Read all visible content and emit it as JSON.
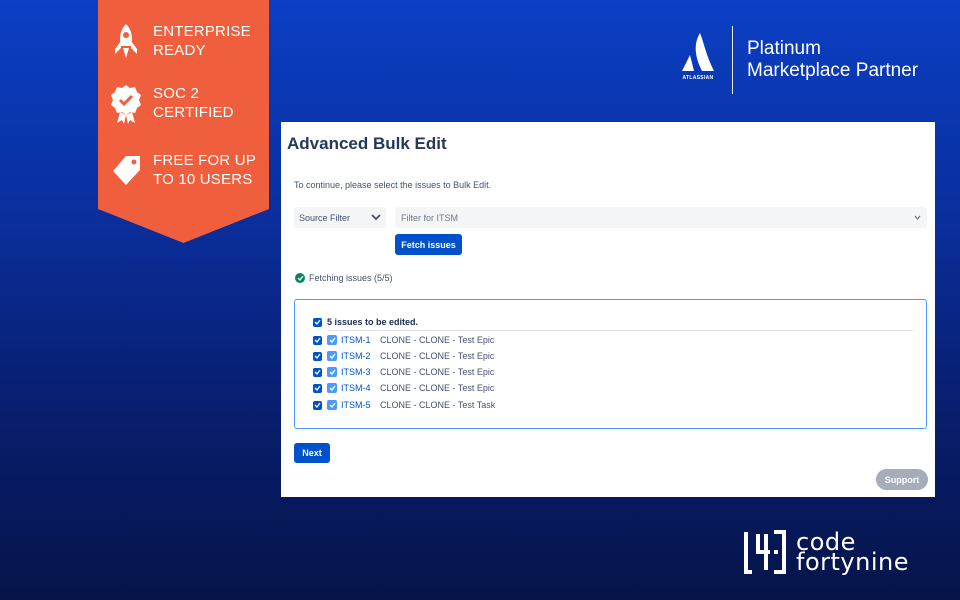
{
  "ribbon": {
    "items": [
      {
        "icon": "rocket-icon",
        "label": "ENTERPRISE READY"
      },
      {
        "icon": "certified-badge-icon",
        "label": "SOC 2 CERTIFIED"
      },
      {
        "icon": "tag-icon",
        "label": "FREE FOR UP TO 10 USERS"
      }
    ],
    "color": "#f05f3d"
  },
  "partner": {
    "logo_word": "ATLASSIAN",
    "line1": "Platinum",
    "line2": "Marketplace Partner"
  },
  "panel": {
    "title": "Advanced Bulk Edit",
    "instruction": "To continue, please select the issues to Bulk Edit.",
    "source_filter": {
      "value": "Source Filter"
    },
    "itsm_filter": {
      "value": "Filter for ITSM"
    },
    "fetch_button": "Fetch issues",
    "fetch_status": "Fetching issues (5/5)",
    "summary": "5 issues to be edited.",
    "issues": [
      {
        "key": "ITSM-1",
        "summary": "CLONE - CLONE - Test Epic"
      },
      {
        "key": "ITSM-2",
        "summary": "CLONE - CLONE - Test Epic"
      },
      {
        "key": "ITSM-3",
        "summary": "CLONE - CLONE - Test Epic"
      },
      {
        "key": "ITSM-4",
        "summary": "CLONE - CLONE - Test Epic"
      },
      {
        "key": "ITSM-5",
        "summary": "CLONE - CLONE - Test Task"
      }
    ],
    "next_button": "Next",
    "support_button": "Support"
  },
  "brand": {
    "line1": "code",
    "line2": "fortynine"
  },
  "colors": {
    "primary": "#0052cc",
    "accent": "#4c9aff",
    "success": "#00875a"
  }
}
